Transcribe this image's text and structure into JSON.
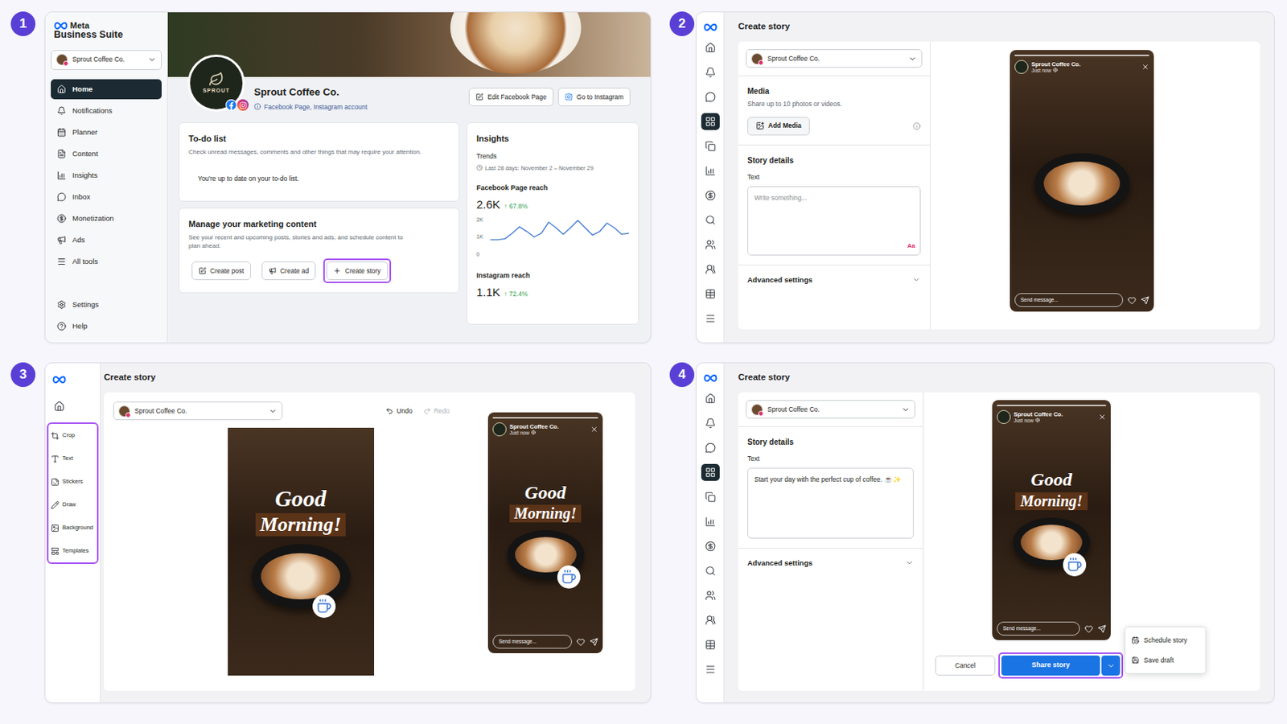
{
  "badges": [
    "1",
    "2",
    "3",
    "4"
  ],
  "panel1": {
    "logo": {
      "brand": "Meta",
      "product": "Business Suite"
    },
    "account": "Sprout Coffee Co.",
    "nav": [
      {
        "label": "Home",
        "selected": true
      },
      {
        "label": "Notifications",
        "selected": false
      },
      {
        "label": "Planner",
        "selected": false
      },
      {
        "label": "Content",
        "selected": false
      },
      {
        "label": "Insights",
        "selected": false
      },
      {
        "label": "Inbox",
        "selected": false
      },
      {
        "label": "Monetization",
        "selected": false
      },
      {
        "label": "Ads",
        "selected": false
      },
      {
        "label": "All tools",
        "selected": false
      }
    ],
    "nav_bottom": [
      {
        "label": "Settings",
        "selected": false
      },
      {
        "label": "Help",
        "selected": false
      }
    ],
    "profile": {
      "avatar_text": "SPROUT",
      "name": "Sprout Coffee Co.",
      "accounts": "Facebook Page, Instagram account",
      "buttons": [
        "Edit Facebook Page",
        "Go to Instagram"
      ]
    },
    "todo": {
      "title": "To-do list",
      "description": "Check unread messages, comments and other things that may require your attention.",
      "message": "You're up to date on your to-do list."
    },
    "marketing": {
      "title": "Manage your marketing content",
      "description": "See your recent and upcoming posts, stories and ads, and schedule content to plan ahead.",
      "buttons": [
        {
          "label": "Create post",
          "highlighted": false
        },
        {
          "label": "Create ad",
          "highlighted": false
        },
        {
          "label": "Create story",
          "highlighted": true
        }
      ]
    },
    "insights": {
      "title": "Insights",
      "subtitle": "Trends",
      "period": "Last 28 days: November 2 – November 29",
      "metrics": [
        {
          "label": "Facebook Page reach",
          "value": "2.6K",
          "change": "↑ 67.8%"
        },
        {
          "label": "Instagram reach",
          "value": "1.1K",
          "change": "↑ 72.4%"
        }
      ],
      "chart": {
        "ticks": [
          "2K",
          "1K",
          "0"
        ],
        "max": 2,
        "series": [
          0.85,
          0.85,
          0.9,
          1.2,
          1.55,
          1.3,
          1.0,
          1.2,
          1.8,
          1.5,
          1.15,
          1.5,
          1.9,
          1.5,
          1.1,
          1.3,
          1.75,
          1.5,
          1.15,
          1.2
        ]
      }
    }
  },
  "panel2": {
    "title": "Create story",
    "account": "Sprout Coffee Co.",
    "rail": [
      {
        "selected": false
      },
      {
        "selected": false
      },
      {
        "selected": false
      },
      {
        "selected": true
      },
      {
        "selected": false
      },
      {
        "selected": false
      },
      {
        "selected": false
      },
      {
        "selected": false
      },
      {
        "selected": false
      },
      {
        "selected": false
      },
      {
        "selected": false
      },
      {
        "selected": false
      }
    ],
    "media": {
      "title": "Media",
      "description": "Share up to 10 photos or videos.",
      "button": "Add Media"
    },
    "details": {
      "title": "Story details",
      "label": "Text",
      "placeholder": "Write something...",
      "style_icon": "Aa"
    },
    "advanced": "Advanced settings",
    "preview": {
      "name": "Sprout Coffee Co.",
      "time": "Just now",
      "reply_placeholder": "Send message..."
    }
  },
  "panel3": {
    "title": "Create story",
    "account": "Sprout Coffee Co.",
    "undo": {
      "label": "Undo",
      "disabled": false
    },
    "redo": {
      "label": "Redo",
      "disabled": true
    },
    "tools": [
      {
        "label": "Crop"
      },
      {
        "label": "Text"
      },
      {
        "label": "Stickers"
      },
      {
        "label": "Draw"
      },
      {
        "label": "Background"
      },
      {
        "label": "Templates"
      }
    ],
    "tools_highlighted": true,
    "overlay_text": [
      "Good",
      "Morning!"
    ],
    "preview": {
      "name": "Sprout Coffee Co.",
      "time": "Just now",
      "reply_placeholder": "Send message..."
    }
  },
  "panel4": {
    "title": "Create story",
    "account": "Sprout Coffee Co.",
    "rail": [
      {
        "selected": false
      },
      {
        "selected": false
      },
      {
        "selected": false
      },
      {
        "selected": true
      },
      {
        "selected": false
      },
      {
        "selected": false
      },
      {
        "selected": false
      },
      {
        "selected": false
      },
      {
        "selected": false
      },
      {
        "selected": false
      },
      {
        "selected": false
      },
      {
        "selected": false
      }
    ],
    "details": {
      "title": "Story details",
      "label": "Text",
      "value": "Start your day with the perfect cup of coffee. ☕✨"
    },
    "advanced": "Advanced settings",
    "overlay_text": [
      "Good",
      "Morning!"
    ],
    "preview": {
      "name": "Sprout Coffee Co.",
      "time": "Just now",
      "reply_placeholder": "Send message..."
    },
    "buttons": {
      "cancel": "Cancel",
      "share": "Share story",
      "share_highlighted": true
    },
    "menu": [
      {
        "label": "Schedule story"
      },
      {
        "label": "Save draft"
      }
    ]
  }
}
